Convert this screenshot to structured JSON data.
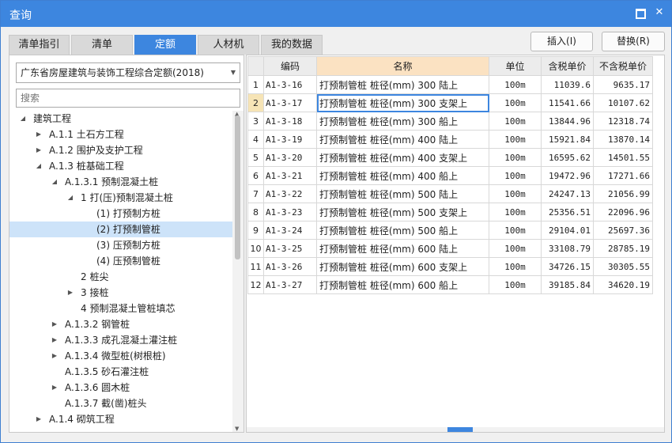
{
  "window": {
    "title": "查询"
  },
  "tabs": [
    {
      "label": "清单指引",
      "active": false
    },
    {
      "label": "清单",
      "active": false
    },
    {
      "label": "定额",
      "active": true
    },
    {
      "label": "人材机",
      "active": false
    },
    {
      "label": "我的数据",
      "active": false
    }
  ],
  "actions": {
    "insert_label": "插入(I)",
    "replace_label": "替换(R)"
  },
  "left": {
    "quota_library": "广东省房屋建筑与装饰工程综合定额(2018)",
    "search_placeholder": "搜索",
    "tree": [
      {
        "label": "建筑工程",
        "level": 0,
        "toggle": "open"
      },
      {
        "label": "A.1.1 土石方工程",
        "level": 1,
        "toggle": "closed"
      },
      {
        "label": "A.1.2 围护及支护工程",
        "level": 1,
        "toggle": "closed"
      },
      {
        "label": "A.1.3 桩基础工程",
        "level": 1,
        "toggle": "open"
      },
      {
        "label": "A.1.3.1 预制混凝土桩",
        "level": 2,
        "toggle": "open"
      },
      {
        "label": "1 打(压)预制混凝土桩",
        "level": 3,
        "toggle": "open"
      },
      {
        "label": "(1) 打预制方桩",
        "level": 4,
        "toggle": "none"
      },
      {
        "label": "(2) 打预制管桩",
        "level": 4,
        "toggle": "none",
        "selected": true
      },
      {
        "label": "(3) 压预制方桩",
        "level": 4,
        "toggle": "none"
      },
      {
        "label": "(4) 压预制管桩",
        "level": 4,
        "toggle": "none"
      },
      {
        "label": "2 桩尖",
        "level": 3,
        "toggle": "none"
      },
      {
        "label": "3 接桩",
        "level": 3,
        "toggle": "closed"
      },
      {
        "label": "4 预制混凝土管桩填芯",
        "level": 3,
        "toggle": "none"
      },
      {
        "label": "A.1.3.2 钢管桩",
        "level": 2,
        "toggle": "closed"
      },
      {
        "label": "A.1.3.3 成孔混凝土灌注桩",
        "level": 2,
        "toggle": "closed"
      },
      {
        "label": "A.1.3.4 微型桩(树根桩)",
        "level": 2,
        "toggle": "closed"
      },
      {
        "label": "A.1.3.5 砂石灌注桩",
        "level": 2,
        "toggle": "none"
      },
      {
        "label": "A.1.3.6 圆木桩",
        "level": 2,
        "toggle": "closed"
      },
      {
        "label": "A.1.3.7 截(凿)桩头",
        "level": 2,
        "toggle": "none"
      },
      {
        "label": "A.1.4 砌筑工程",
        "level": 1,
        "toggle": "closed"
      }
    ]
  },
  "grid": {
    "columns": [
      "",
      "编码",
      "名称",
      "单位",
      "含税单价",
      "不含税单价"
    ],
    "rows": [
      {
        "idx": "1",
        "code": "A1-3-16",
        "name": "打预制管桩 桩径(mm) 300 陆上",
        "unit": "100m",
        "tax_price": "11039.6",
        "notax_price": "9635.17"
      },
      {
        "idx": "2",
        "code": "A1-3-17",
        "name": "打预制管桩 桩径(mm) 300 支架上",
        "unit": "100m",
        "tax_price": "11541.66",
        "notax_price": "10107.62"
      },
      {
        "idx": "3",
        "code": "A1-3-18",
        "name": "打预制管桩 桩径(mm) 300 船上",
        "unit": "100m",
        "tax_price": "13844.96",
        "notax_price": "12318.74"
      },
      {
        "idx": "4",
        "code": "A1-3-19",
        "name": "打预制管桩 桩径(mm) 400 陆上",
        "unit": "100m",
        "tax_price": "15921.84",
        "notax_price": "13870.14"
      },
      {
        "idx": "5",
        "code": "A1-3-20",
        "name": "打预制管桩 桩径(mm) 400 支架上",
        "unit": "100m",
        "tax_price": "16595.62",
        "notax_price": "14501.55"
      },
      {
        "idx": "6",
        "code": "A1-3-21",
        "name": "打预制管桩 桩径(mm) 400 船上",
        "unit": "100m",
        "tax_price": "19472.96",
        "notax_price": "17271.66"
      },
      {
        "idx": "7",
        "code": "A1-3-22",
        "name": "打预制管桩 桩径(mm) 500 陆上",
        "unit": "100m",
        "tax_price": "24247.13",
        "notax_price": "21056.99"
      },
      {
        "idx": "8",
        "code": "A1-3-23",
        "name": "打预制管桩 桩径(mm) 500 支架上",
        "unit": "100m",
        "tax_price": "25356.51",
        "notax_price": "22096.96"
      },
      {
        "idx": "9",
        "code": "A1-3-24",
        "name": "打预制管桩 桩径(mm) 500 船上",
        "unit": "100m",
        "tax_price": "29104.01",
        "notax_price": "25697.36"
      },
      {
        "idx": "10",
        "code": "A1-3-25",
        "name": "打预制管桩 桩径(mm) 600 陆上",
        "unit": "100m",
        "tax_price": "33108.79",
        "notax_price": "28785.19"
      },
      {
        "idx": "11",
        "code": "A1-3-26",
        "name": "打预制管桩 桩径(mm) 600 支架上",
        "unit": "100m",
        "tax_price": "34726.15",
        "notax_price": "30305.55"
      },
      {
        "idx": "12",
        "code": "A1-3-27",
        "name": "打预制管桩 桩径(mm) 600 船上",
        "unit": "100m",
        "tax_price": "39185.84",
        "notax_price": "34620.19"
      }
    ],
    "current_row": 2
  },
  "colors": {
    "accent": "#3d86df",
    "header_highlight": "#fbe2c2",
    "selected_row": "#cde3f9"
  }
}
